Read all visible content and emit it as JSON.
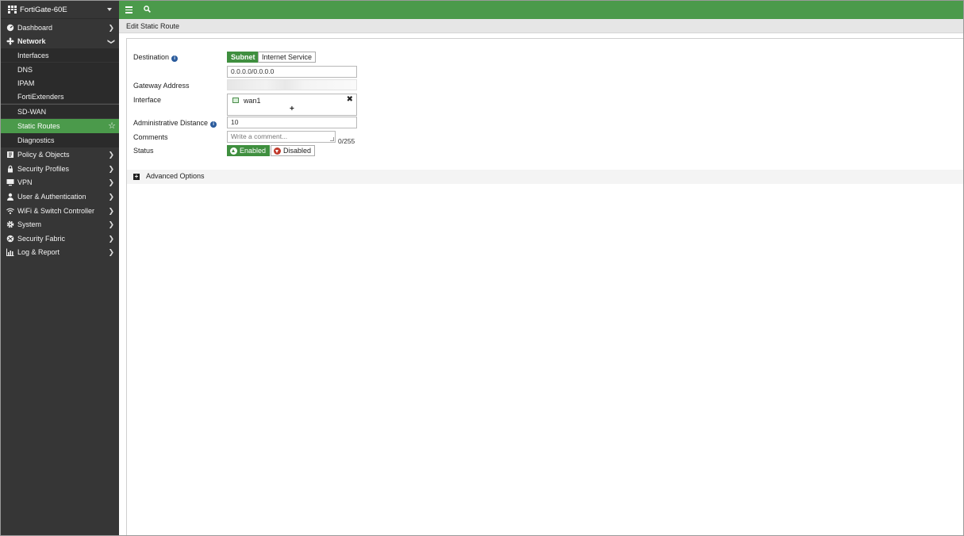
{
  "device": {
    "name": "FortiGate-60E"
  },
  "sidebar": {
    "items": [
      {
        "label": "Dashboard",
        "icon": "dashboard-icon"
      },
      {
        "label": "Network",
        "icon": "network-icon"
      },
      {
        "label": "Interfaces"
      },
      {
        "label": "DNS"
      },
      {
        "label": "IPAM"
      },
      {
        "label": "FortiExtenders"
      },
      {
        "label": "SD-WAN"
      },
      {
        "label": "Static Routes"
      },
      {
        "label": "Diagnostics"
      },
      {
        "label": "Policy & Objects",
        "icon": "policy-icon"
      },
      {
        "label": "Security Profiles",
        "icon": "lock-icon"
      },
      {
        "label": "VPN",
        "icon": "monitor-icon"
      },
      {
        "label": "User & Authentication",
        "icon": "user-icon"
      },
      {
        "label": "WiFi & Switch Controller",
        "icon": "wifi-icon"
      },
      {
        "label": "System",
        "icon": "gear-icon"
      },
      {
        "label": "Security Fabric",
        "icon": "fabric-icon"
      },
      {
        "label": "Log & Report",
        "icon": "chart-icon"
      }
    ]
  },
  "topbar": {
    "menu_icon": "hamburger-icon",
    "search_icon": "search-icon"
  },
  "breadcrumb": {
    "title": "Edit Static Route"
  },
  "form": {
    "destination": {
      "label": "Destination",
      "subnet": "Subnet",
      "internet_service": "Internet Service",
      "value": "0.0.0.0/0.0.0.0"
    },
    "gateway": {
      "label": "Gateway Address"
    },
    "interface": {
      "label": "Interface",
      "value": "wan1"
    },
    "admin_distance": {
      "label": "Administrative Distance",
      "value": "10"
    },
    "comments": {
      "label": "Comments",
      "placeholder": "Write a comment...",
      "counter": "0/255"
    },
    "status": {
      "label": "Status",
      "enabled": "Enabled",
      "disabled": "Disabled"
    },
    "advanced": {
      "label": "Advanced Options"
    }
  },
  "colors": {
    "accent": "#4b9a4b",
    "sidebar": "#363636",
    "info": "#2a5b9c",
    "disabled": "#c0392b"
  }
}
